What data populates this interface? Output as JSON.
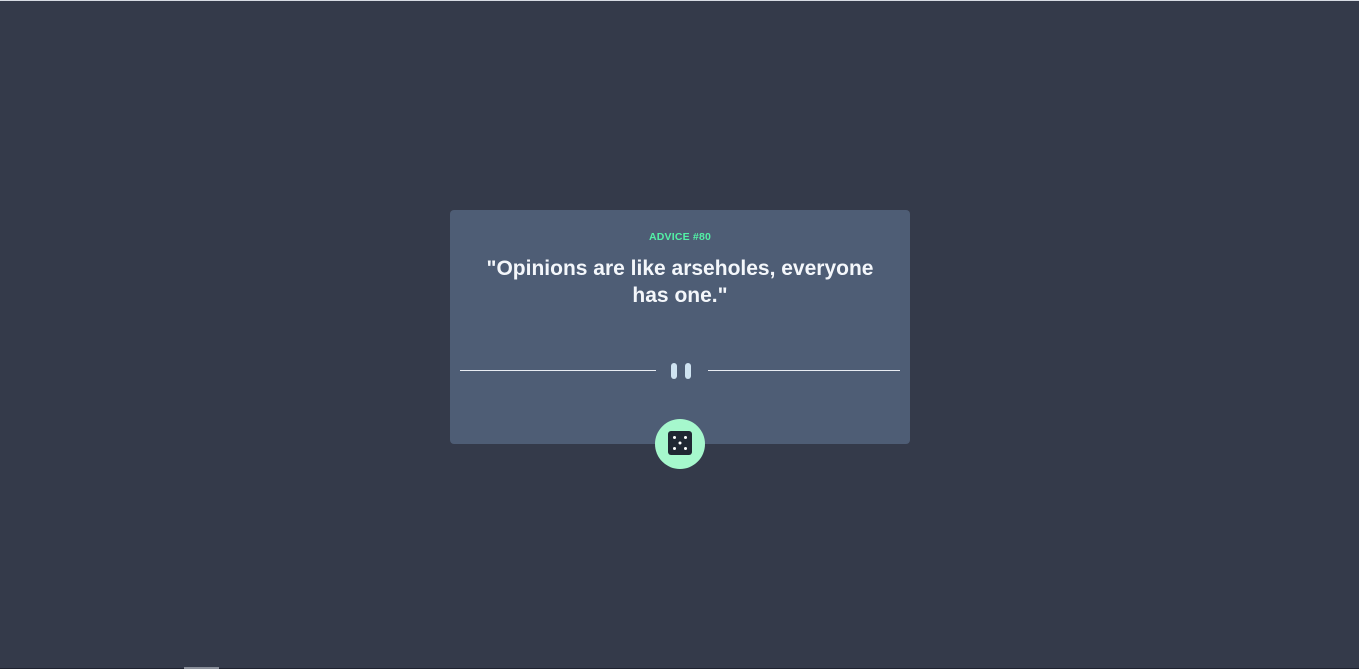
{
  "advice": {
    "label": "ADVICE #80",
    "quote": "\"Opinions are like arseholes, everyone has one.\""
  },
  "icons": {
    "divider": "pause-icon",
    "button": "dice-icon"
  },
  "colors": {
    "background": "#343a4a",
    "card": "#4e5d75",
    "accent": "#53f1a6",
    "button": "#a6f8cd",
    "text": "#f4f7fb"
  }
}
